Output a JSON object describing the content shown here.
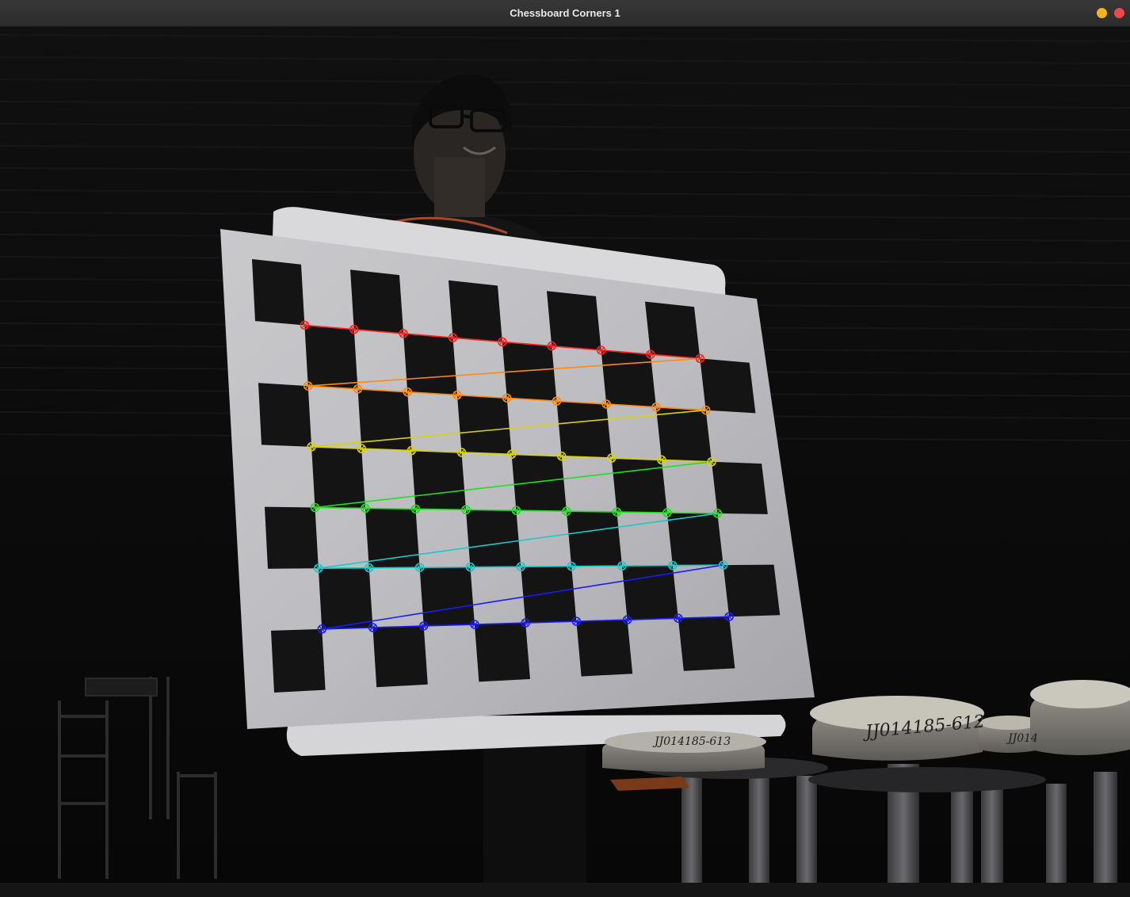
{
  "window": {
    "title": "Chessboard Corners 1",
    "controls": [
      "minimize",
      "close"
    ],
    "minimize_color": "#f5b31c",
    "close_color": "#e9494f"
  },
  "image": {
    "stamp_labels": [
      "JJ014185-612",
      "JJ014185-613",
      "JJ014"
    ]
  },
  "detection": {
    "pattern_size": {
      "cols": 9,
      "rows": 6
    },
    "row_colors": [
      "#ff2020",
      "#ff8a10",
      "#d9d20a",
      "#1fe01f",
      "#19c9c9",
      "#1a1aff"
    ]
  }
}
